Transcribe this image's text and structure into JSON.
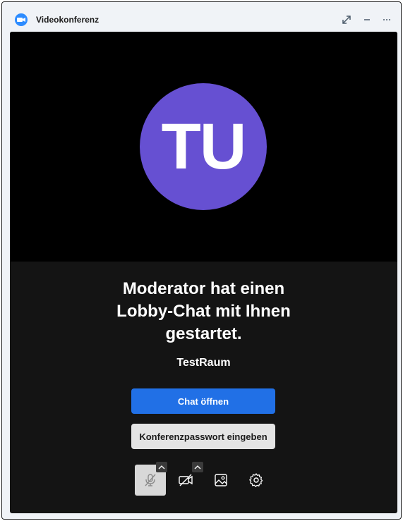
{
  "window": {
    "title": "Videokonferenz",
    "app_icon": "video-camera-icon",
    "controls": [
      "expand-icon",
      "minimize-icon",
      "more-icon"
    ]
  },
  "avatar": {
    "initials": "TU",
    "color": "#6650d2"
  },
  "lobby": {
    "message_lines": [
      "Moderator hat einen",
      "Lobby-Chat mit Ihnen",
      "gestartet."
    ],
    "room_name": "TestRaum"
  },
  "buttons": {
    "open_chat": "Chat öffnen",
    "enter_password": "Konferenzpasswort eingeben"
  },
  "toolbar": {
    "items": [
      "microphone-muted-icon",
      "camera-off-icon",
      "background-image-icon",
      "gear-icon"
    ]
  },
  "colors": {
    "accent": "#2170e6",
    "stage_bg": "#141414",
    "video_bg": "#000000",
    "window_bg": "#f0f3f7"
  }
}
